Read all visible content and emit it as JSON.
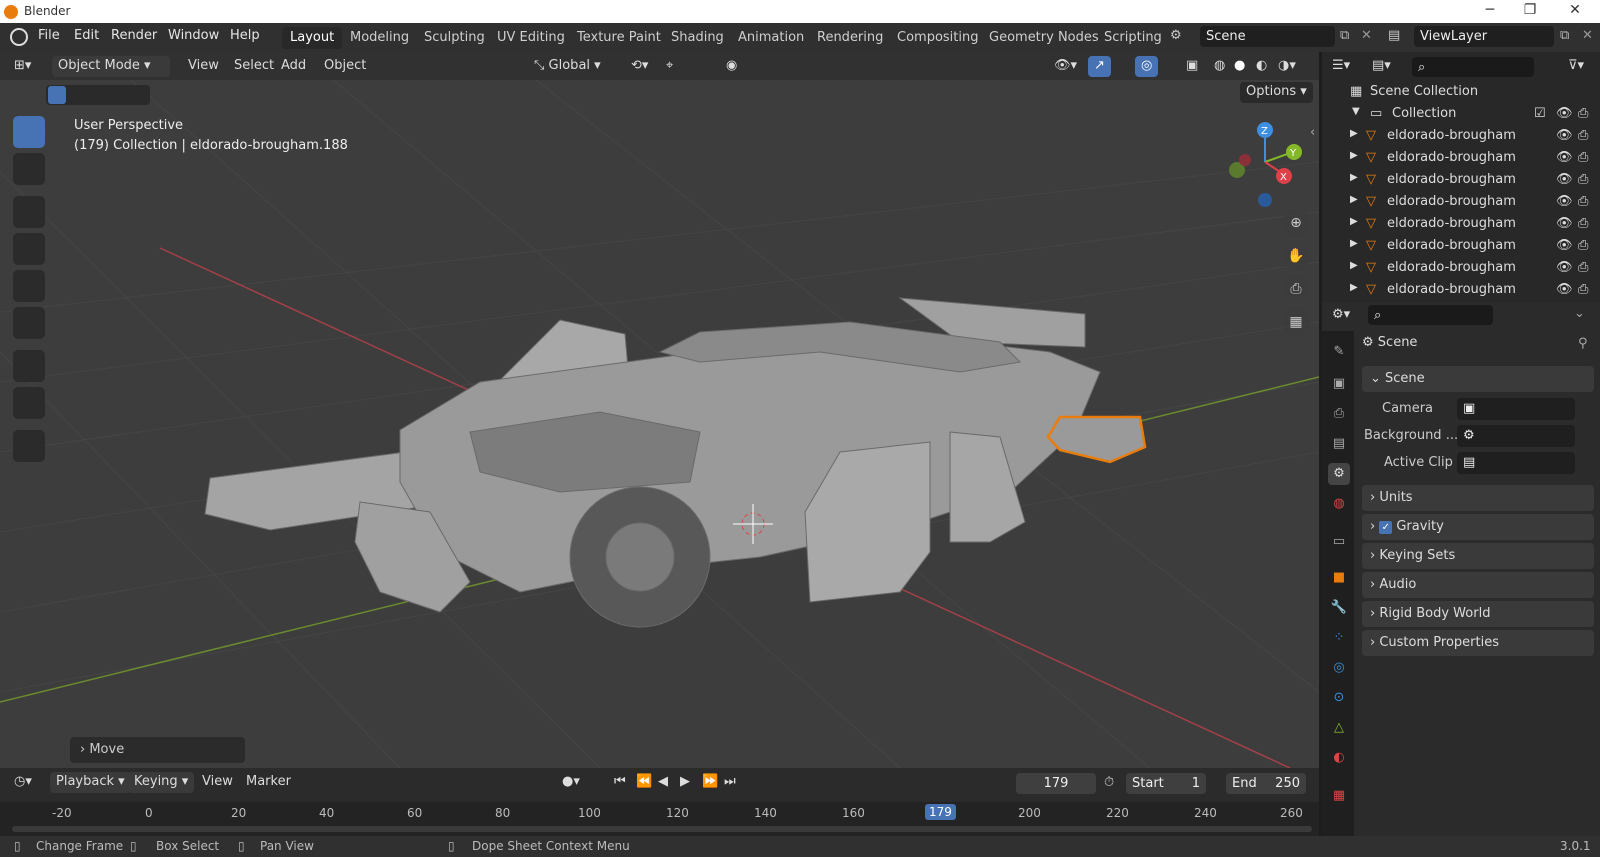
{
  "window": {
    "title": "Blender",
    "version": "3.0.1"
  },
  "menus": [
    "File",
    "Edit",
    "Render",
    "Window",
    "Help"
  ],
  "workspaces": [
    "Layout",
    "Modeling",
    "Sculpting",
    "UV Editing",
    "Texture Paint",
    "Shading",
    "Animation",
    "Rendering",
    "Compositing",
    "Geometry Nodes",
    "Scripting"
  ],
  "scene_name": "Scene",
  "view_layer": "ViewLayer",
  "viewport": {
    "mode": "Object Mode",
    "menus": [
      "View",
      "Select",
      "Add",
      "Object"
    ],
    "orientation": "Global",
    "options": "Options",
    "overlay_title": "User Perspective",
    "overlay_info": "(179) Collection | eldorado-brougham.188",
    "last_op": "Move",
    "axes": {
      "x": "X",
      "y": "Y",
      "z": "Z"
    }
  },
  "timeline": {
    "menus": [
      "Playback",
      "Keying",
      "View",
      "Marker"
    ],
    "current": "179",
    "start_label": "Start",
    "start": "1",
    "end_label": "End",
    "end": "250",
    "ticks": [
      "-20",
      "0",
      "20",
      "40",
      "60",
      "80",
      "100",
      "120",
      "140",
      "160",
      "179",
      "200",
      "220",
      "240",
      "260"
    ]
  },
  "status": {
    "items": [
      "Change Frame",
      "Box Select",
      "Pan View",
      "Dope Sheet Context Menu"
    ]
  },
  "outliner": {
    "root": "Scene Collection",
    "collection": "Collection",
    "objects": [
      "eldorado-brougham",
      "eldorado-brougham",
      "eldorado-brougham",
      "eldorado-brougham",
      "eldorado-brougham",
      "eldorado-brougham",
      "eldorado-brougham",
      "eldorado-brougham"
    ]
  },
  "properties": {
    "header": "Scene",
    "panel": "Scene",
    "camera_label": "Camera",
    "background_label": "Background ...",
    "active_clip_label": "Active Clip",
    "collapsed": [
      "Units",
      "Gravity",
      "Keying Sets",
      "Audio",
      "Rigid Body World",
      "Custom Properties"
    ]
  },
  "colors": {
    "accent": "#4772b3",
    "orange": "#e87d0d",
    "x_axis": "#e0404a",
    "y_axis": "#84b828",
    "z_axis": "#3d8fe0"
  }
}
